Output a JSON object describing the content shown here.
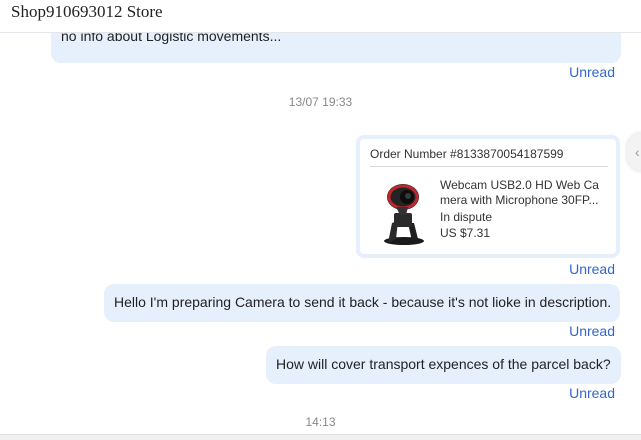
{
  "header": {
    "store_name": "Shop910693012 Store"
  },
  "messages": {
    "first": {
      "text": "no info about Logistic movements...",
      "status": "Unread"
    },
    "timestamp_1": "13/07 19:33",
    "order_card": {
      "order_number": "Order Number #8133870054187599",
      "product_name": "Webcam USB2.0 HD Web Camera with Microphone 30FP...",
      "product_status": "In dispute",
      "price": "US $7.31",
      "status": "Unread"
    },
    "second": {
      "text": "Hello I'm preparing Camera to send it back - because it's not lioke in description.",
      "status": "Unread"
    },
    "third": {
      "text": "How will cover transport expences of the parcel back?",
      "status": "Unread"
    },
    "timestamp_2": "14:13"
  },
  "colors": {
    "bubble_bg": "#e6effc",
    "unread_link": "#3366cc",
    "timestamp_text": "#888888"
  },
  "icons": {
    "product_image": "webcam-icon",
    "side_button": "chevron-icon"
  }
}
